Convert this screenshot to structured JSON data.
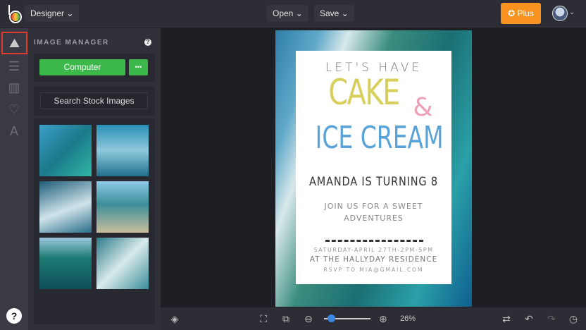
{
  "topbar": {
    "designer": "Designer",
    "open": "Open",
    "save": "Save",
    "plus": "Plus"
  },
  "panel": {
    "title": "IMAGE MANAGER",
    "computer": "Computer",
    "more": "•••",
    "search": "Search Stock Images"
  },
  "design": {
    "line1": "LET'S HAVE",
    "line2": "CAKE",
    "amp": "&",
    "line3": "ICE CREAM",
    "line4": "AMANDA IS TURNING 8",
    "line5a": "JOIN US FOR A SWEET",
    "line5b": "ADVENTURES",
    "line6": "SATURDAY-APRIL 27TH-2PM-5PM",
    "line7": "AT THE HALLYDAY RESIDENCE",
    "line8": "RSVP TO MIA@GMAIL.COM"
  },
  "colors": {
    "yellow": "#d8cf5a",
    "pink": "#eea0b5",
    "blue": "#5aa3d8",
    "accent": "#f7931e",
    "green": "#3db84a"
  },
  "bottom": {
    "zoom_label": "26%",
    "zoom_value": 26
  }
}
